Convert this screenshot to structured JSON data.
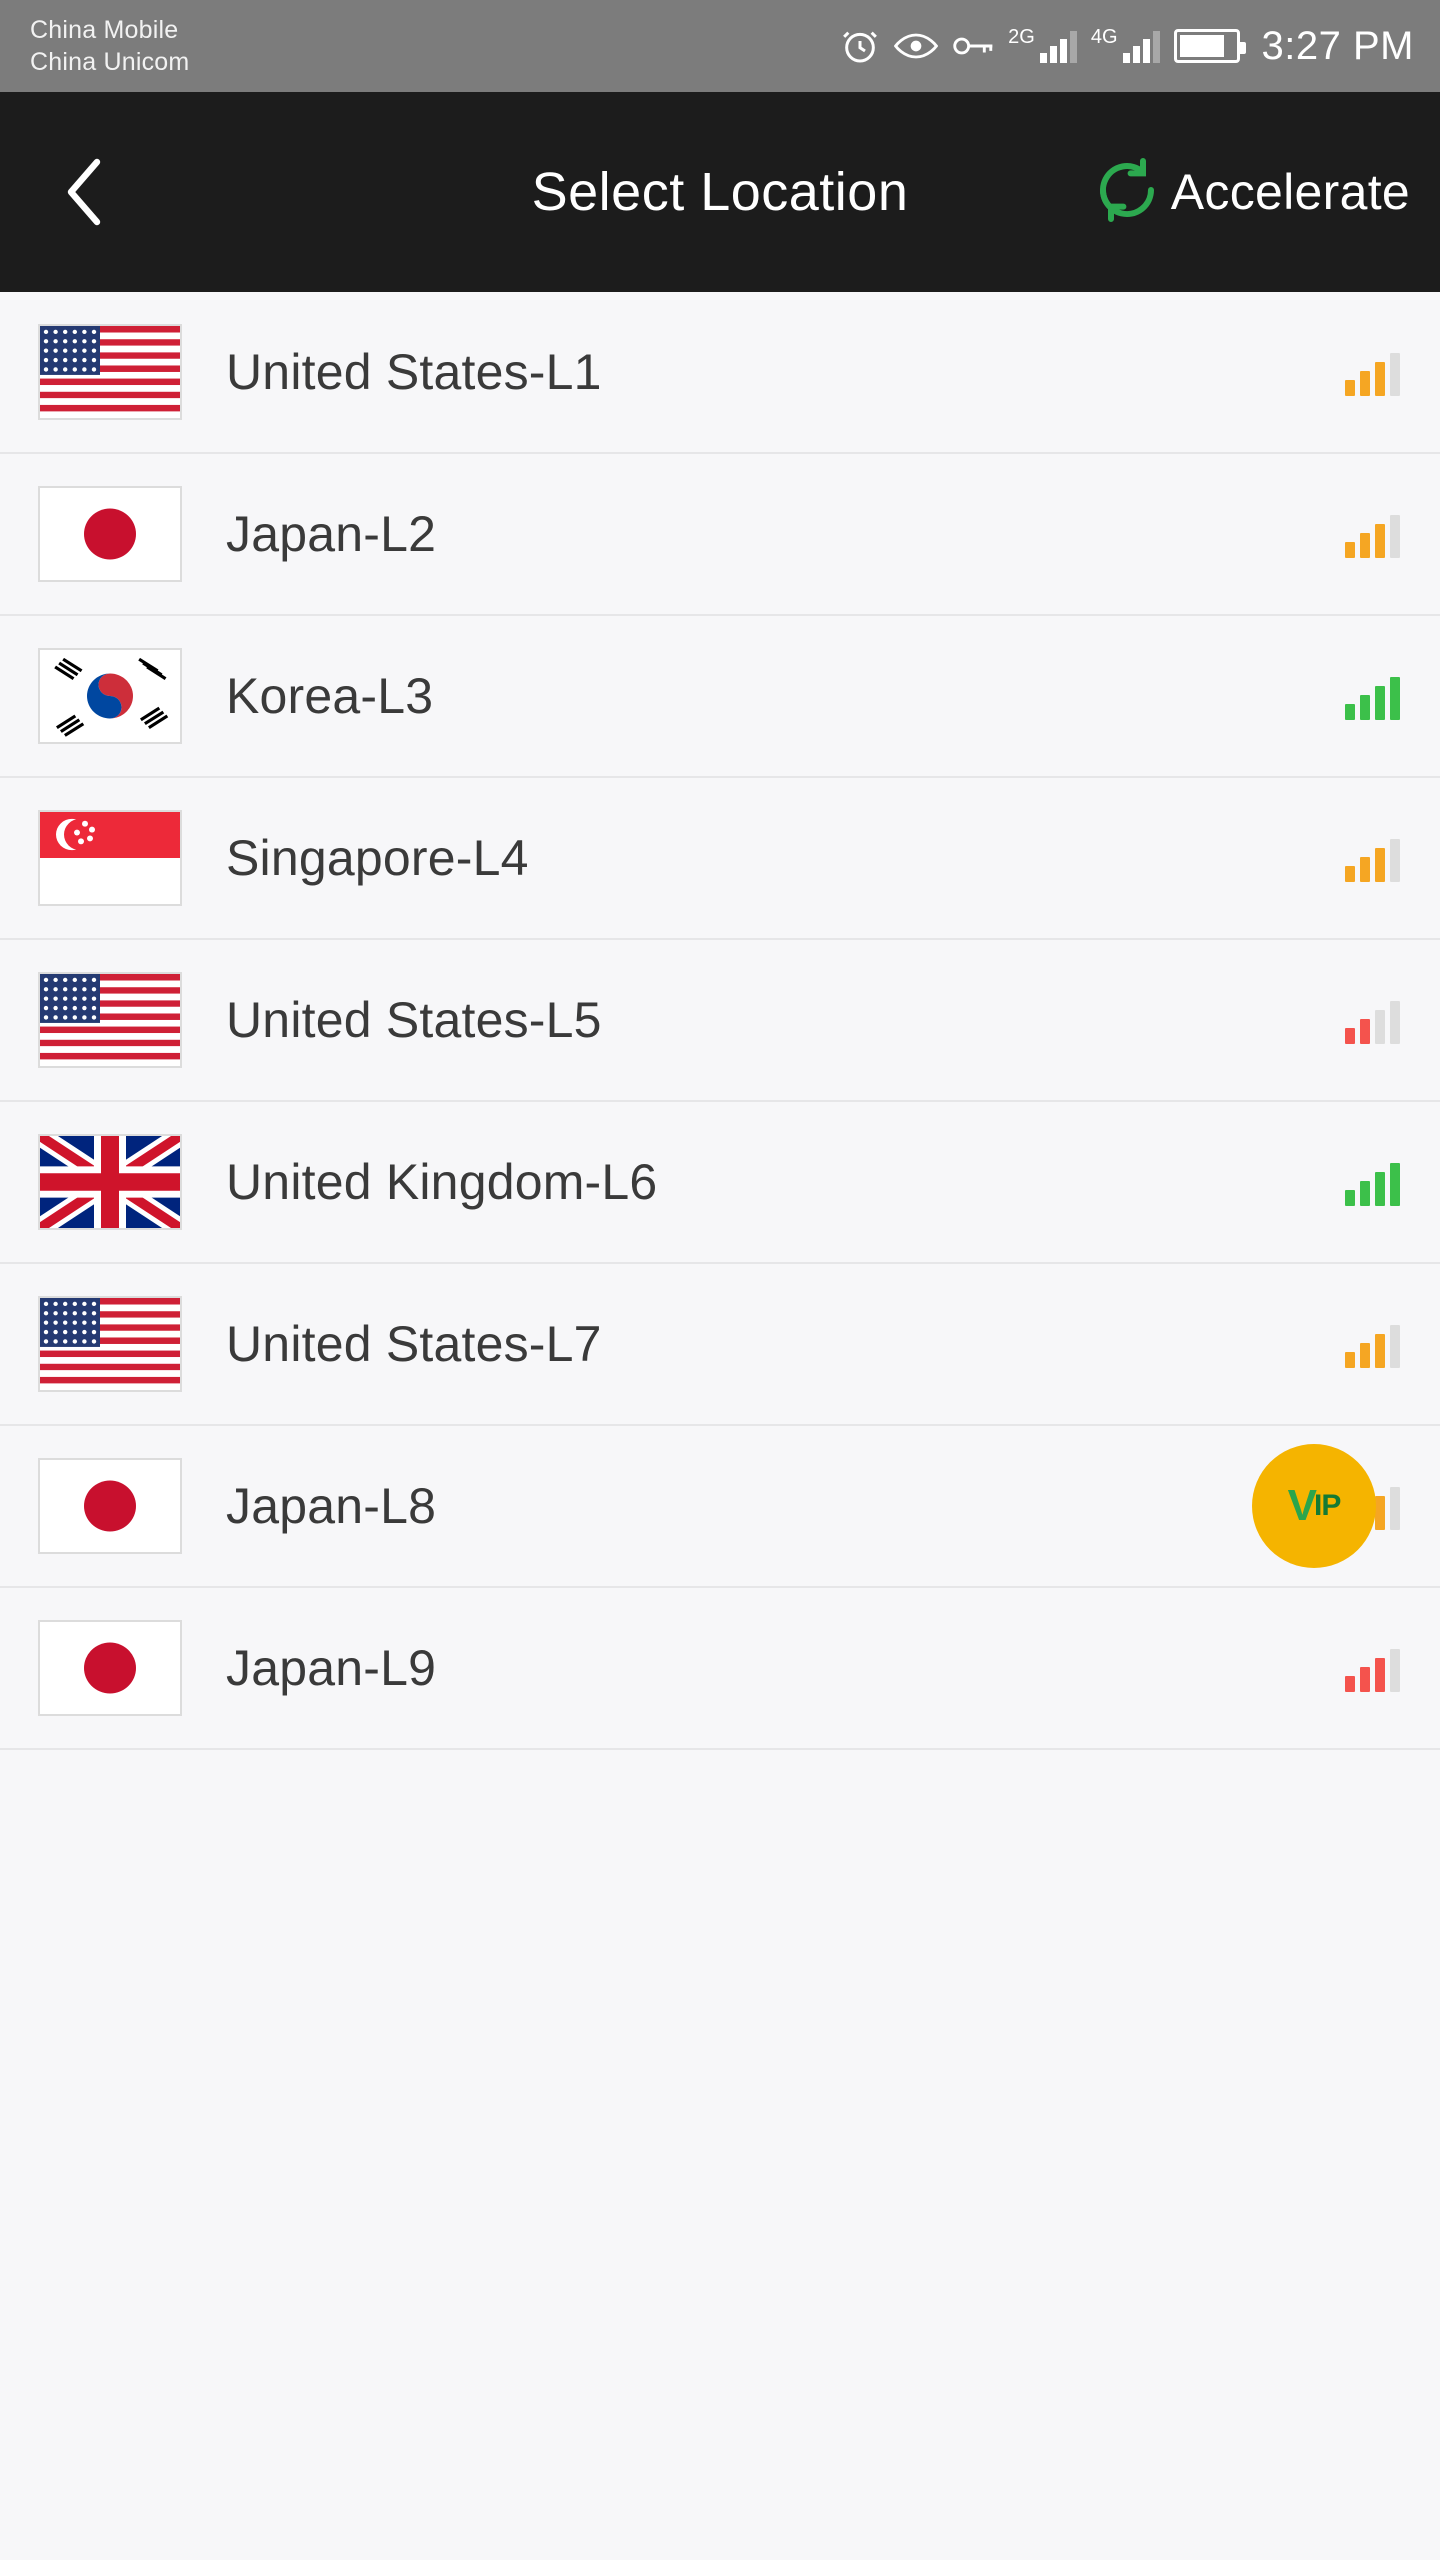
{
  "status_bar": {
    "carriers": [
      "China Mobile",
      "China Unicom"
    ],
    "time": "3:27 PM",
    "icons": [
      "alarm-icon",
      "eye-icon",
      "key-icon"
    ],
    "network_labels": [
      "2G",
      "4G"
    ],
    "battery_level": "82"
  },
  "title_bar": {
    "back_icon": "chevron-left-icon",
    "title": "Select Location",
    "accelerate_label": "Accelerate",
    "accelerate_icon": "refresh-circle-icon",
    "accent_color": "#2ca94f",
    "background": "#1c1c1c"
  },
  "locations": [
    {
      "name": "United States-L1",
      "flag": "us",
      "signal_bars": 3,
      "signal_color": "#f5a623",
      "vip": false
    },
    {
      "name": "Japan-L2",
      "flag": "jp",
      "signal_bars": 3,
      "signal_color": "#f5a623",
      "vip": false
    },
    {
      "name": "Korea-L3",
      "flag": "kr",
      "signal_bars": 4,
      "signal_color": "#3cc04a",
      "vip": false
    },
    {
      "name": "Singapore-L4",
      "flag": "sg",
      "signal_bars": 3,
      "signal_color": "#f5a623",
      "vip": false
    },
    {
      "name": "United States-L5",
      "flag": "us",
      "signal_bars": 2,
      "signal_color": "#f4534d",
      "vip": false
    },
    {
      "name": "United Kingdom-L6",
      "flag": "gb",
      "signal_bars": 4,
      "signal_color": "#3cc04a",
      "vip": false
    },
    {
      "name": "United States-L7",
      "flag": "us",
      "signal_bars": 3,
      "signal_color": "#f5a623",
      "vip": false
    },
    {
      "name": "Japan-L8",
      "flag": "jp",
      "signal_bars": 3,
      "signal_color": "#f5a623",
      "vip": true
    },
    {
      "name": "Japan-L9",
      "flag": "jp",
      "signal_bars": 3,
      "signal_color": "#f4534d",
      "vip": false
    }
  ],
  "vip_badge": {
    "label_main": "V",
    "label_sub": "IP",
    "color": "#f5b400"
  }
}
